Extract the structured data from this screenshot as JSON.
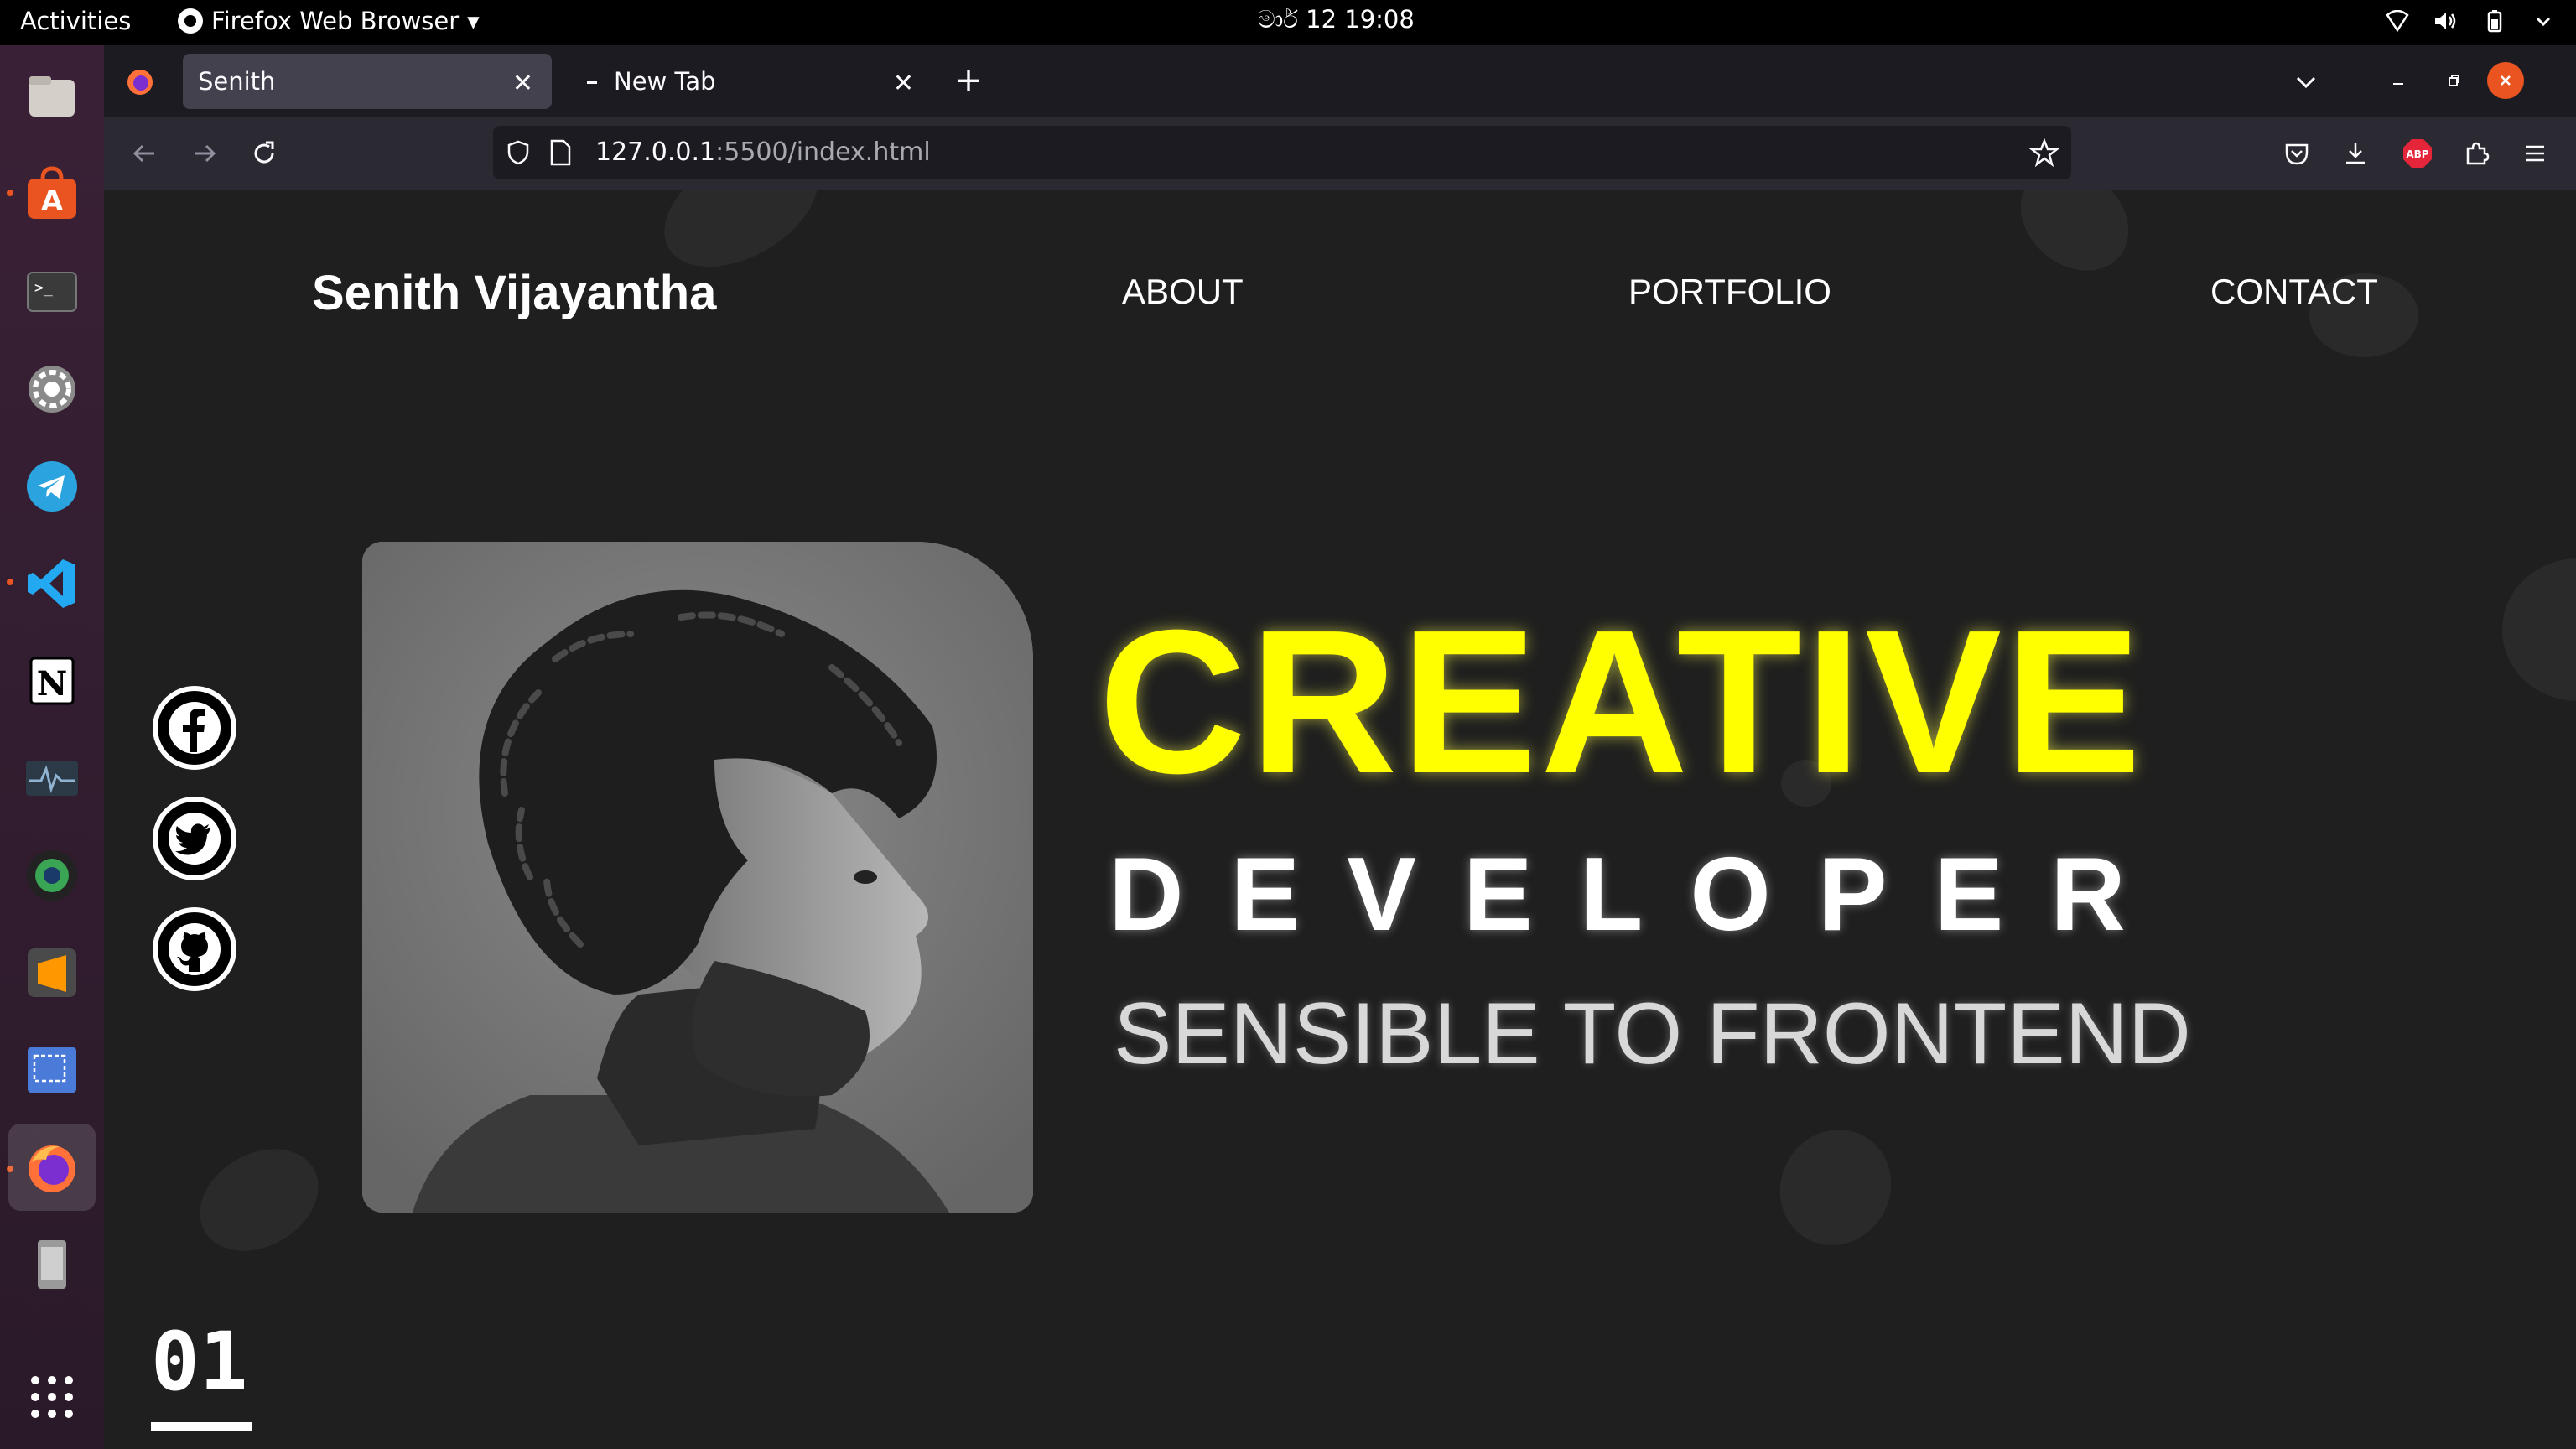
{
  "system_bar": {
    "activities": "Activities",
    "app_name": "Firefox Web Browser",
    "clock": "මාර් 12  19:08",
    "tray": [
      "network-icon",
      "volume-icon",
      "battery-icon",
      "power-menu-icon"
    ]
  },
  "dock": {
    "items": [
      {
        "name": "files",
        "icon": "files-icon"
      },
      {
        "name": "software",
        "icon": "app-store-icon"
      },
      {
        "name": "terminal",
        "icon": "terminal-icon"
      },
      {
        "name": "settings",
        "icon": "settings-icon"
      },
      {
        "name": "telegram",
        "icon": "telegram-icon"
      },
      {
        "name": "vscode",
        "icon": "vscode-icon"
      },
      {
        "name": "notion",
        "icon": "notion-icon"
      },
      {
        "name": "system-monitor",
        "icon": "monitor-icon"
      },
      {
        "name": "camera",
        "icon": "camera-icon"
      },
      {
        "name": "sublime-text",
        "icon": "sublime-icon"
      },
      {
        "name": "screenshot",
        "icon": "screenshot-icon"
      },
      {
        "name": "firefox",
        "icon": "firefox-icon"
      },
      {
        "name": "usb-drive",
        "icon": "drive-icon"
      },
      {
        "name": "show-apps",
        "icon": "grid-icon"
      }
    ]
  },
  "browser": {
    "tabs": [
      {
        "label": "Senith",
        "active": true
      },
      {
        "label": "New Tab",
        "active": false
      }
    ],
    "url_host": "127.0.0.1",
    "url_rest": ":5500/index.html",
    "abp_label": "ABP"
  },
  "page": {
    "site_name": "Senith Vijayantha",
    "nav": {
      "about": "ABOUT",
      "portfolio": "PORTFOLIO",
      "contact": "CONTACT"
    },
    "headline": "CREATIVE",
    "subheadline": "DEVELOPER",
    "tagline": "SENSIBLE TO FRONTEND",
    "section_number": "01",
    "social": [
      "facebook-icon",
      "twitter-icon",
      "github-icon"
    ],
    "accent_color": "#ffff00"
  }
}
